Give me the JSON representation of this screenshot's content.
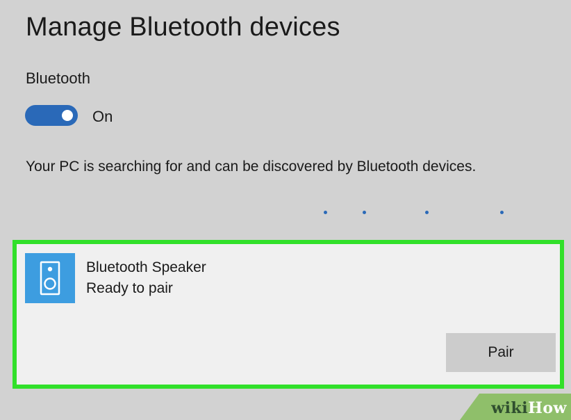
{
  "page": {
    "title": "Manage Bluetooth devices"
  },
  "bluetooth": {
    "section_label": "Bluetooth",
    "toggle_on": true,
    "toggle_state_label": "On",
    "status_message": "Your PC is searching for and can be discovered by Bluetooth devices."
  },
  "device": {
    "name": "Bluetooth Speaker",
    "status": "Ready to pair",
    "icon": "speaker-icon",
    "pair_label": "Pair",
    "highlight_color": "#31e02a"
  },
  "watermark": {
    "wiki": "wiki",
    "how": "How"
  },
  "colors": {
    "accent": "#2a69b8",
    "icon_tile": "#3d9de0",
    "background": "#d2d2d2",
    "card": "#f0f0f0"
  }
}
